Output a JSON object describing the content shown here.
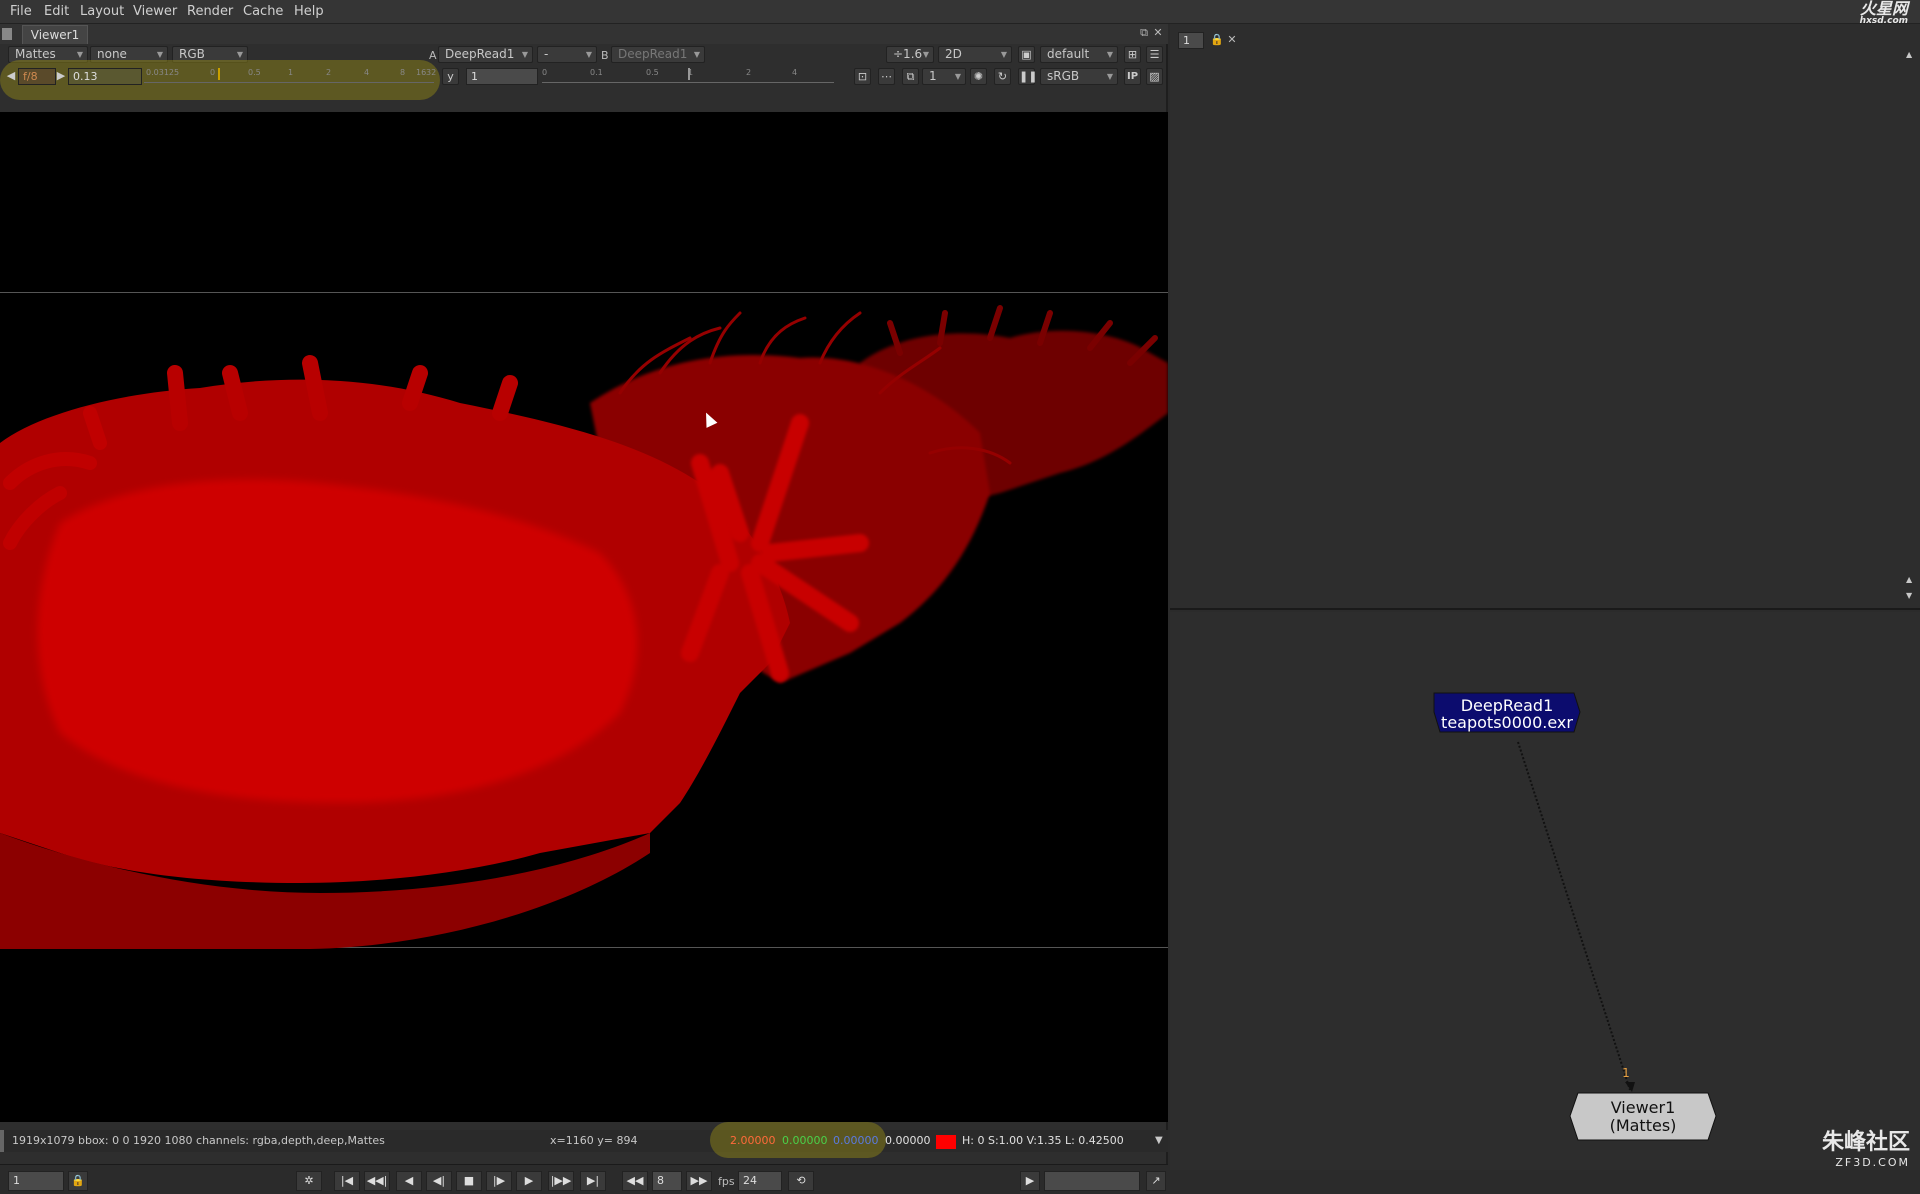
{
  "menu": [
    "File",
    "Edit",
    "Layout",
    "Viewer",
    "Render",
    "Cache",
    "Help"
  ],
  "logo": {
    "main": "火星网",
    "sub": "hxsd.com"
  },
  "viewer": {
    "tab": "Viewer1",
    "toolbar1": {
      "layer": "Mattes",
      "channel_none": "none",
      "display": "RGB",
      "a_label": "A",
      "a_input": "DeepRead1",
      "op": "-",
      "b_label": "B",
      "b_input": "DeepRead1",
      "zoom": "÷1.6",
      "mode": "2D",
      "lut": "default"
    },
    "toolbar2": {
      "fstop": "f/8",
      "gain": "0.13",
      "gain_ticks": [
        "0.03125",
        "0",
        "0.5",
        "1",
        "2",
        "4",
        "8",
        "16",
        "32"
      ],
      "gamma_label": "y",
      "gamma": "1",
      "gamma_ticks": [
        "0",
        "0.1",
        "0.5",
        "1",
        "2",
        "4"
      ],
      "proxy": "1",
      "colorspace": "sRGB",
      "ip": "IP"
    }
  },
  "info": {
    "format": "1919x1079 bbox: 0 0 1920 1080 channels: rgba,depth,deep,Mattes",
    "coords": "x=1160 y= 894",
    "r": "2.00000",
    "g": "0.00000",
    "b": "0.00000",
    "a": "0.00000",
    "hsvl": "H:   0 S:1.00 V:1.35  L: 0.42500",
    "swatch_color": "#ff0000"
  },
  "playback": {
    "frame": "1",
    "skip": "8",
    "fps_label": "fps",
    "fps": "24"
  },
  "properties": {
    "max_panels": "1"
  },
  "dag": {
    "read_node": {
      "title": "DeepRead1",
      "file": "teapots0000.exr"
    },
    "viewer_node": {
      "title": "Viewer1",
      "sub": "(Mattes)"
    },
    "input_label": "1"
  },
  "watermark": {
    "main": "朱峰社区",
    "sub": "ZF3D.COM"
  },
  "colors": {
    "image_red": "#c80000",
    "read_node": "#0c0c6e",
    "viewer_node": "#c8c8c8",
    "highlight": "#968c14"
  }
}
